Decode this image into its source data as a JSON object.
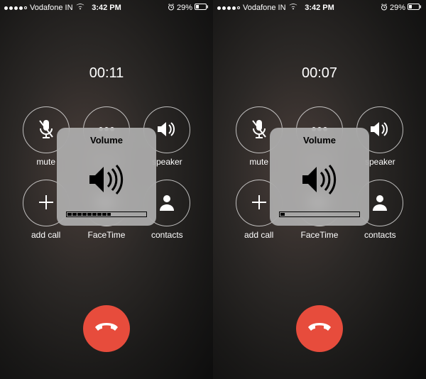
{
  "screens": [
    {
      "statusbar": {
        "carrier": "Vodafone IN",
        "time": "3:42 PM",
        "battery_pct": "29%"
      },
      "call_timer": "00:11",
      "buttons": {
        "mute": "mute",
        "keypad": "keypad",
        "speaker": "speaker",
        "addcall": "add call",
        "facetime": "FaceTime",
        "contacts": "contacts"
      },
      "volume_hud": {
        "title": "Volume",
        "level": 9,
        "max": 16
      }
    },
    {
      "statusbar": {
        "carrier": "Vodafone IN",
        "time": "3:42 PM",
        "battery_pct": "29%"
      },
      "call_timer": "00:07",
      "buttons": {
        "mute": "mute",
        "keypad": "keypad",
        "speaker": "speaker",
        "addcall": "add call",
        "facetime": "FaceTime",
        "contacts": "contacts"
      },
      "volume_hud": {
        "title": "Volume",
        "level": 1,
        "max": 16
      }
    }
  ]
}
